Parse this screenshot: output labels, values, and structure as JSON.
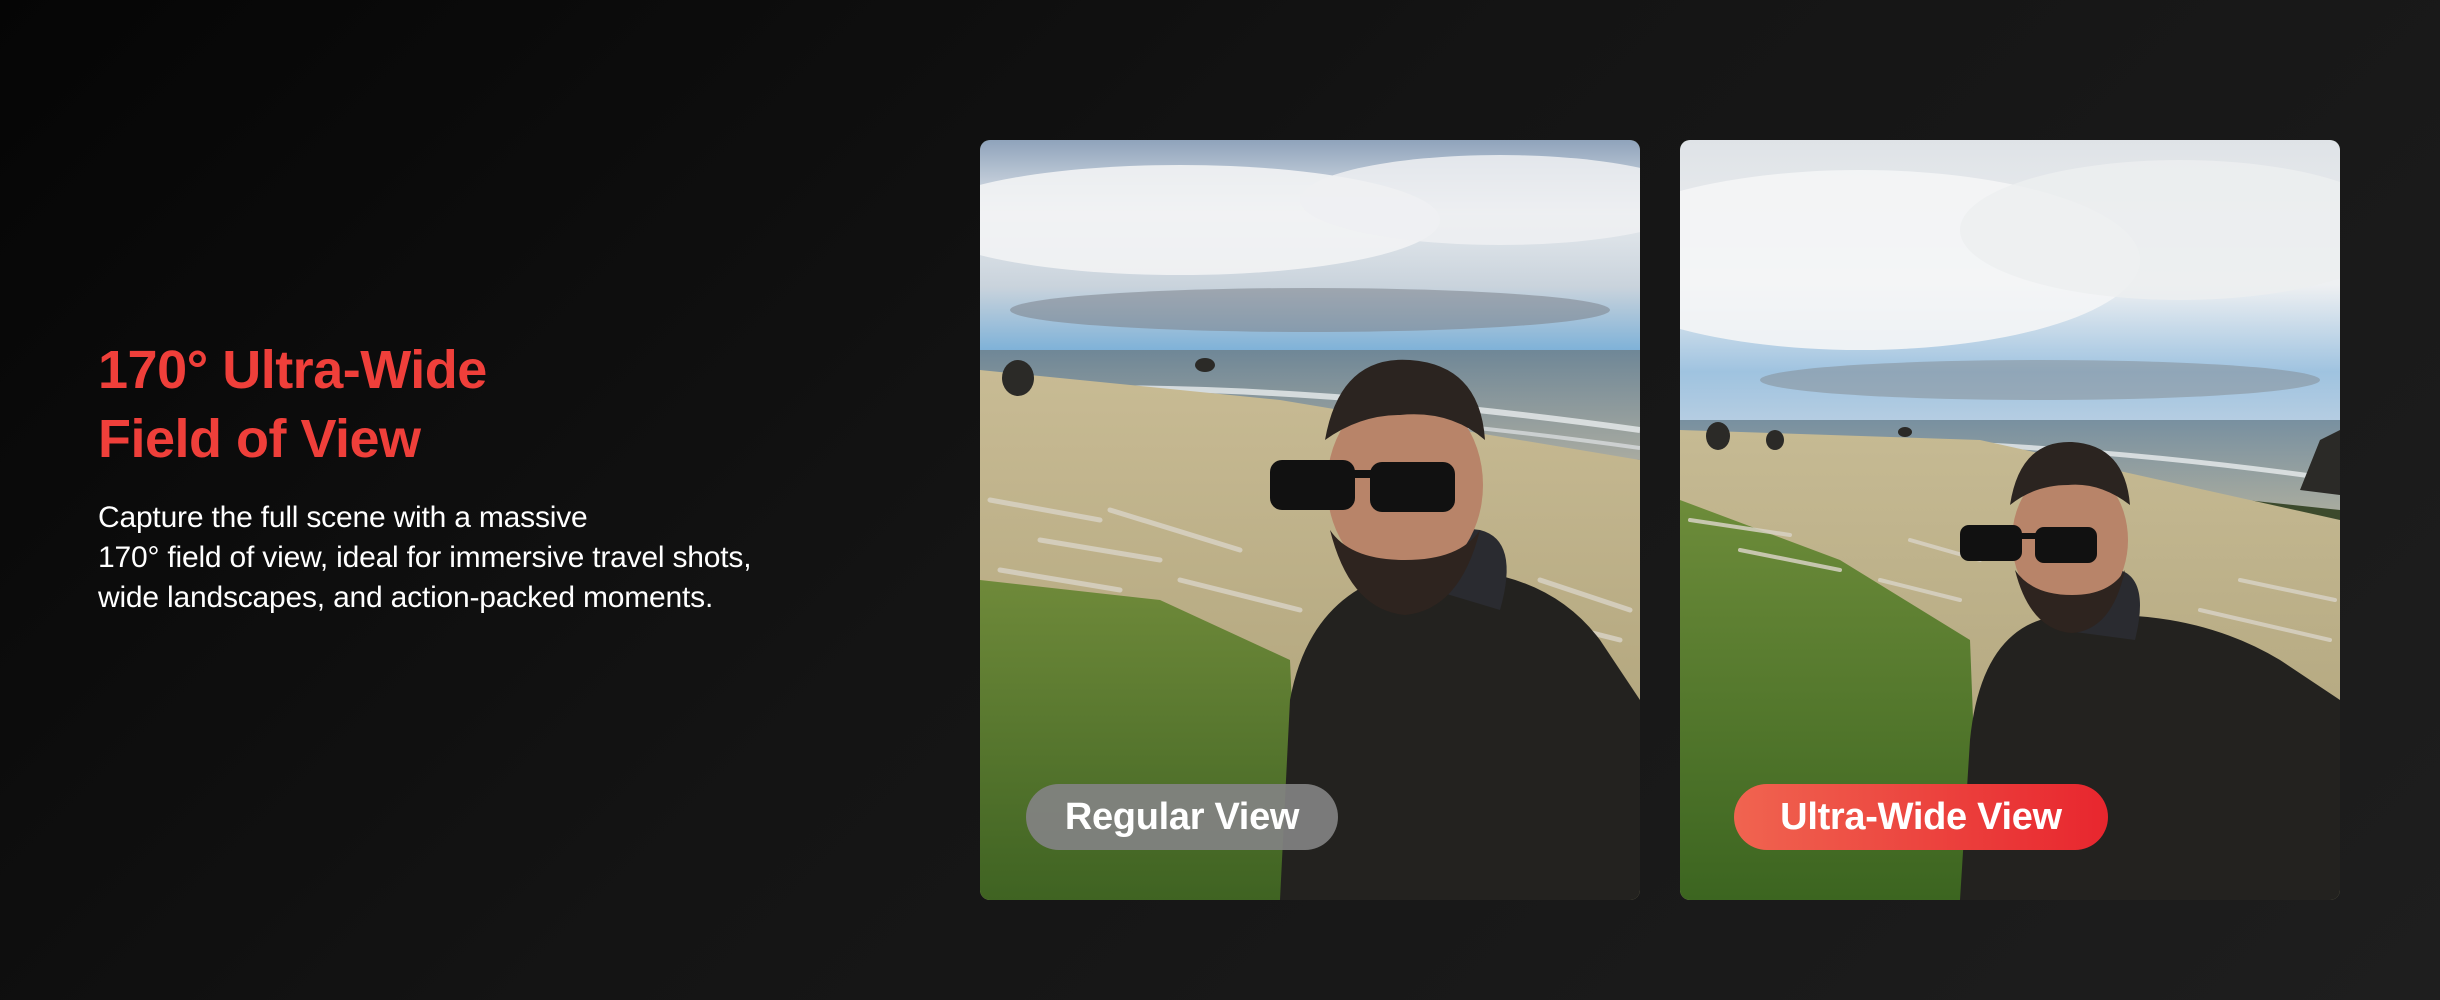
{
  "hero": {
    "title_line1": "170° Ultra-Wide",
    "title_line2": "Field of View",
    "description_line1": "Capture the full scene with a massive",
    "description_line2": "170° field of view, ideal for immersive travel shots,",
    "description_line3": "wide landscapes, and action-packed moments."
  },
  "comparison": {
    "regular_label": "Regular View",
    "wide_label": "Ultra-Wide View"
  },
  "colors": {
    "accent": "#ef3f3a",
    "background": "#111111",
    "regular_pill": "#828282",
    "wide_pill_start": "#f06450",
    "wide_pill_end": "#e8262e"
  }
}
